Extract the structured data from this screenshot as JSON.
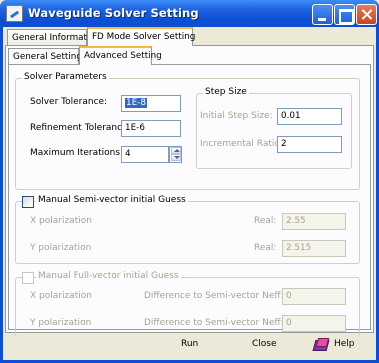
{
  "window": {
    "title": "Waveguide Solver Setting"
  },
  "tabs_top": [
    {
      "label": "General Information"
    },
    {
      "label": "FD Mode Solver Setting"
    }
  ],
  "tabs_sub": [
    {
      "label": "General Setting"
    },
    {
      "label": "Advanced Setting"
    }
  ],
  "solver": {
    "group_label": "Solver Parameters",
    "tolerance_label": "Solver Tolerance:",
    "tolerance_value": "1E-8",
    "refinement_label": "Refinement Tolerance:",
    "refinement_value": "1E-6",
    "max_iter_label": "Maximum Iterations:",
    "max_iter_value": "4"
  },
  "step": {
    "group_label": "Step Size",
    "initial_label": "Initial Step Size:",
    "initial_value": "0.01",
    "ratio_label": "Incremental Ratio:",
    "ratio_value": "2"
  },
  "semi": {
    "check_label": "Manual Semi-vector initial Guess",
    "x_label": "X polarization",
    "x_real_label": "Real:",
    "x_real_value": "2.55",
    "y_label": "Y polarization",
    "y_real_label": "Real:",
    "y_real_value": "2.515"
  },
  "full": {
    "check_label": "Manual Full-vector initial Guess",
    "x_label": "X polarization",
    "x_diff_label": "Difference to Semi-vector  Neff:",
    "x_diff_value": "0",
    "y_label": "Y polarization",
    "y_diff_label": "Difference to Semi-vector  Neff:",
    "y_diff_value": "0"
  },
  "footer": {
    "run_label": "Run",
    "close_label": "Close",
    "help_label": "Help"
  },
  "icons": {
    "app": "app-icon",
    "minimize": "minimize-icon",
    "maximize": "maximize-icon",
    "close": "close-icon",
    "help": "help-book-icon"
  }
}
